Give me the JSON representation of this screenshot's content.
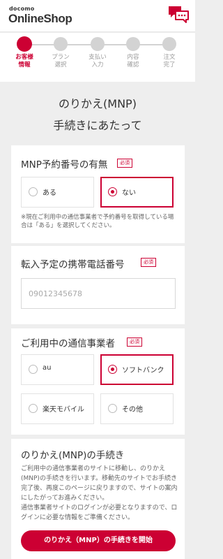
{
  "header": {
    "logo_top": "docomo",
    "logo_main": "OnlineShop",
    "chat_icon": "chat-icon"
  },
  "steps": [
    {
      "line1": "お客様",
      "line2": "情報",
      "active": true
    },
    {
      "line1": "プラン",
      "line2": "選択",
      "active": false
    },
    {
      "line1": "支払い",
      "line2": "入力",
      "active": false
    },
    {
      "line1": "内容",
      "line2": "確認",
      "active": false
    },
    {
      "line1": "注文",
      "line2": "完了",
      "active": false
    }
  ],
  "page_title": {
    "line1": "のりかえ(MNP)",
    "line2": "手続きにあたって"
  },
  "mnp_number": {
    "label": "MNP予約番号の有無",
    "required": "必須",
    "options": [
      "ある",
      "ない"
    ],
    "selected": "ない",
    "note": "※現在ご利用中の通信事業者で予約番号を取得している場合は「ある」を選択してください。"
  },
  "phone_number": {
    "label": "転入予定の携帯電話番号",
    "required": "必須",
    "placeholder": "09012345678",
    "value": ""
  },
  "carrier": {
    "label": "ご利用中の通信事業者",
    "required": "必須",
    "options": [
      "au",
      "ソフトバンク",
      "楽天モバイル",
      "その他"
    ],
    "selected": "ソフトバンク"
  },
  "mnp_procedure": {
    "title": "のりかえ(MNP)の手続き",
    "description_1": "ご利用中の通信事業者のサイトに移動し、のりかえ(MNP)の手続きを行います。移動先のサイトでお手続き完了後、再度このページに戻りますので、サイトの案内にしたがってお進みください。",
    "description_2": "通信事業者サイトのログインが必要となりますので、ログインに必要な情報をご準備ください。",
    "button": "のりかえ（MNP）の手続きを開始"
  },
  "colors": {
    "brand": "#cc0033",
    "inactive": "#d3d3d3",
    "background": "#eeeeee"
  }
}
